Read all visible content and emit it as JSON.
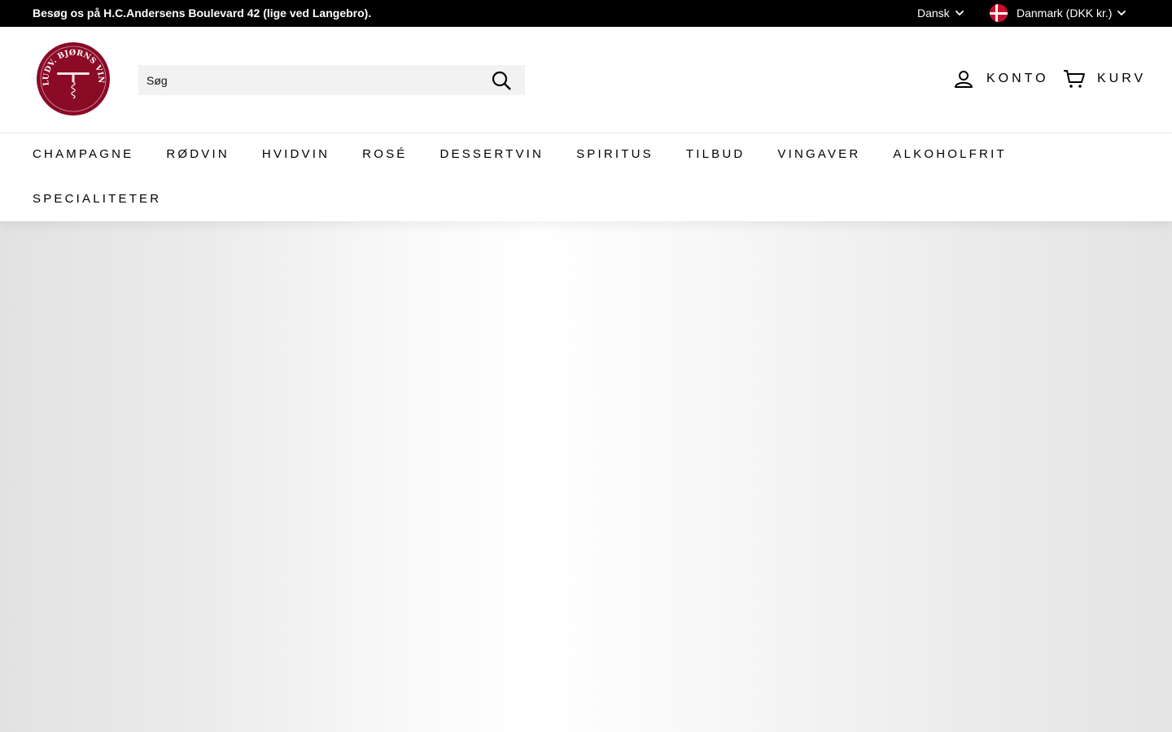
{
  "announcement": {
    "message": "Besøg os på H.C.Andersens Boulevard 42 (lige ved Langebro)."
  },
  "localization": {
    "language": "Dansk",
    "country": "Danmark (DKK kr.)",
    "flag_icon": "denmark-flag-icon"
  },
  "header": {
    "logo_text": "LUDV. BJØRNS VINHANDEL",
    "logo_color": "#8b0a26",
    "search": {
      "placeholder": "Søg"
    },
    "account_label": "KONTO",
    "cart_label": "KURV"
  },
  "nav": {
    "items": [
      "CHAMPAGNE",
      "RØDVIN",
      "HVIDVIN",
      "ROSÉ",
      "DESSERTVIN",
      "SPIRITUS",
      "TILBUD",
      "VINGAVER",
      "ALKOHOLFRIT",
      "SPECIALITETER"
    ]
  },
  "colors": {
    "topbar_bg": "#000000",
    "brand_red": "#8b0a26",
    "search_bg": "#f2f2f2"
  }
}
